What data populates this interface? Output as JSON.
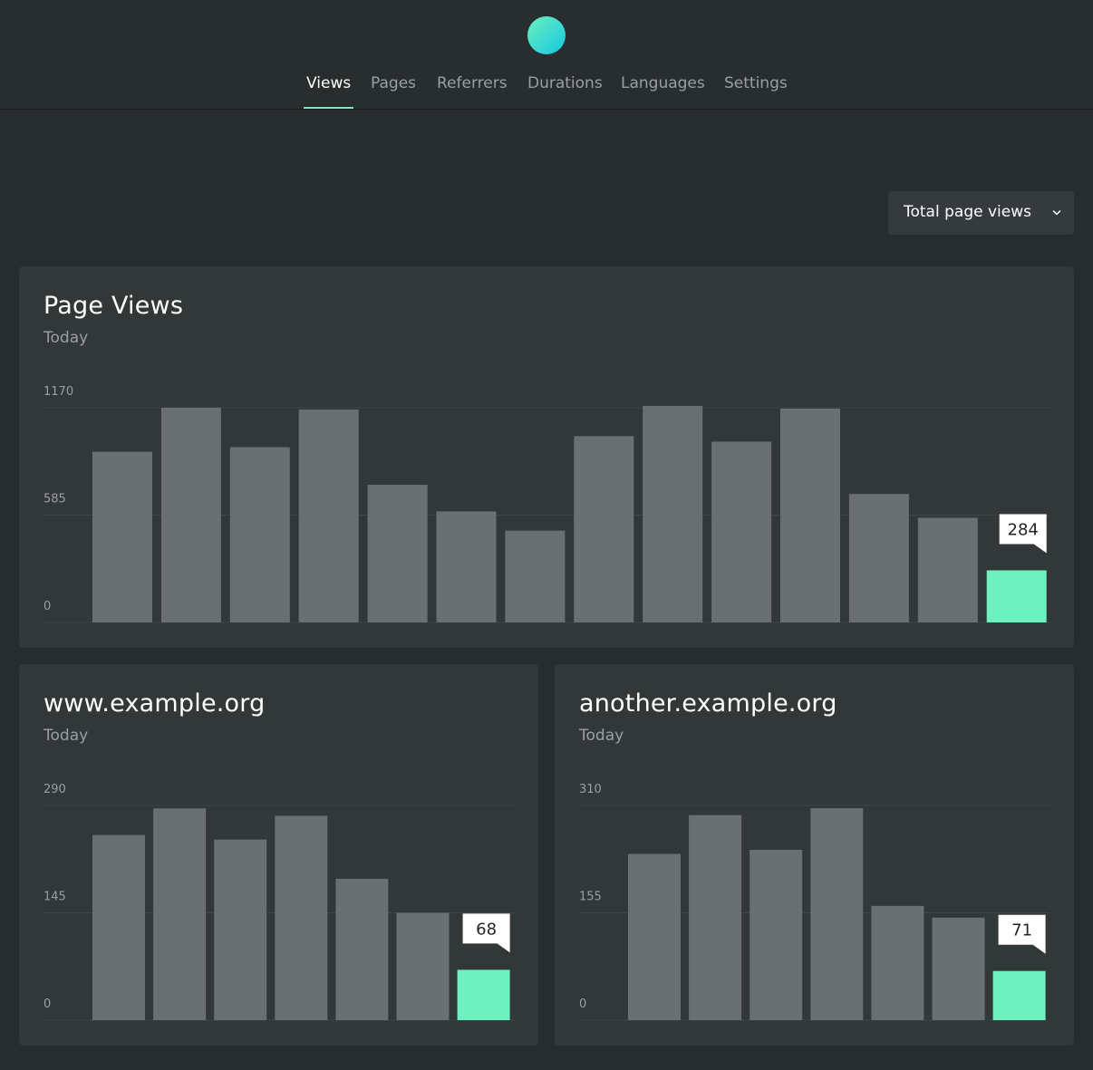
{
  "nav": {
    "items": [
      {
        "label": "Views",
        "active": true
      },
      {
        "label": "Pages",
        "active": false
      },
      {
        "label": "Referrers",
        "active": false
      },
      {
        "label": "Durations",
        "active": false
      },
      {
        "label": "Languages",
        "active": false
      },
      {
        "label": "Settings",
        "active": false
      }
    ]
  },
  "filter": {
    "selected": "Total page views",
    "icon": "chevron-down-icon"
  },
  "colors": {
    "accent": "#6ff0c0",
    "bar": "#6a7070",
    "background": "#272c2d",
    "card": "#323738"
  },
  "cards": [
    {
      "title": "Page Views",
      "subtitle": "Today",
      "chart_data": {
        "type": "bar",
        "ylim": [
          0,
          1170
        ],
        "yticks": [
          "1170",
          "585",
          "0"
        ],
        "values": [
          930,
          1170,
          955,
          1160,
          750,
          605,
          500,
          1015,
          1180,
          985,
          1165,
          700,
          570,
          284
        ],
        "highlight_index": 13,
        "highlight_label": "284"
      }
    },
    {
      "title": "www.example.org",
      "subtitle": "Today",
      "chart_data": {
        "type": "bar",
        "ylim": [
          0,
          290
        ],
        "yticks": [
          "290",
          "145",
          "0"
        ],
        "values": [
          250,
          286,
          244,
          276,
          191,
          145,
          68
        ],
        "highlight_index": 6,
        "highlight_label": "68"
      }
    },
    {
      "title": "another.example.org",
      "subtitle": "Today",
      "chart_data": {
        "type": "bar",
        "ylim": [
          0,
          310
        ],
        "yticks": [
          "310",
          "155",
          "0"
        ],
        "values": [
          240,
          296,
          246,
          306,
          165,
          148,
          71
        ],
        "highlight_index": 6,
        "highlight_label": "71"
      }
    }
  ]
}
